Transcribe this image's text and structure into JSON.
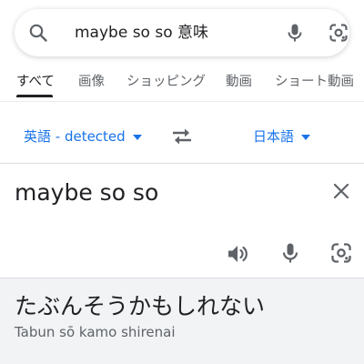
{
  "search": {
    "query": "maybe so so 意味"
  },
  "tabs": [
    {
      "label": "すべて",
      "active": true
    },
    {
      "label": "画像",
      "active": false
    },
    {
      "label": "ショッピング",
      "active": false
    },
    {
      "label": "動画",
      "active": false
    },
    {
      "label": "ショート動画",
      "active": false
    }
  ],
  "translate": {
    "source_lang": "英語 - detected",
    "target_lang": "日本語",
    "source_text": "maybe so so",
    "result_text": "たぶんそうかもしれない",
    "romanization": "Tabun sō kamo shirenai"
  },
  "colors": {
    "accent": "#1a73e8",
    "result_bg": "#f1f3f4",
    "icon_gray": "#5f6368"
  },
  "icons": [
    "search-icon",
    "mic-icon",
    "google-lens-icon",
    "swap-icon",
    "clear-icon",
    "speaker-icon"
  ]
}
